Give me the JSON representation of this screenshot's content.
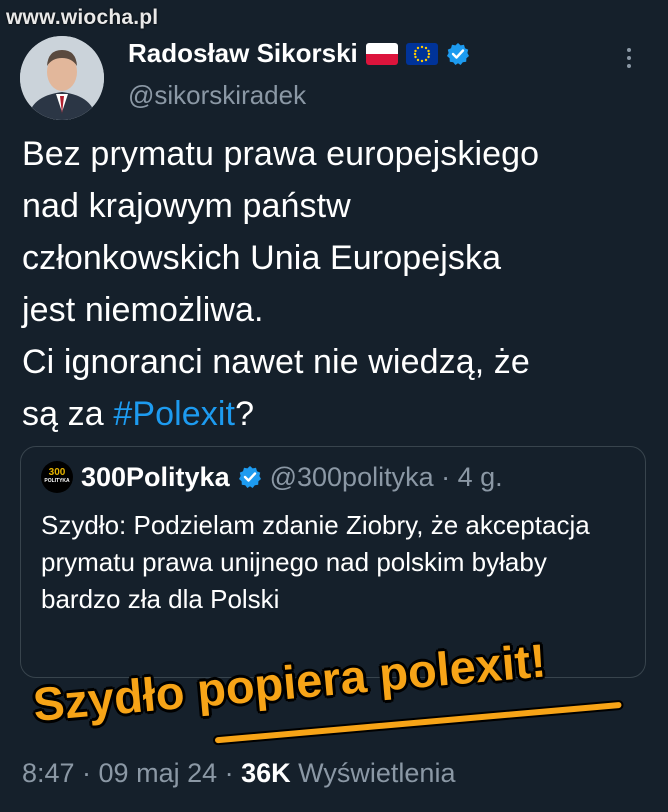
{
  "watermark": "www.wiocha.pl",
  "author": {
    "name": "Radosław Sikorski",
    "handle": "@sikorskiradek",
    "flags": [
      "poland-flag-icon",
      "eu-flag-icon"
    ],
    "verified_icon": "verified-badge-icon"
  },
  "tweet": {
    "lines": [
      "Bez prymatu prawa europejskiego",
      "nad krajowym państw",
      "członkowskich Unia Europejska",
      "jest niemożliwa.",
      "Ci ignoranci nawet nie wiedzą, że"
    ],
    "last_line_prefix": "są za ",
    "hashtag": "#Polexit",
    "last_line_suffix": "?"
  },
  "quote": {
    "logo_text_top": "300",
    "logo_text_bottom": "POLITYKA",
    "name": "300Polityka",
    "handle_time": "@300polityka · 4 g.",
    "text": "Szydło: Podzielam zdanie Ziobry, że akceptacja prymatu prawa unijnego nad polskim byłaby bardzo zła dla Polski"
  },
  "overlay_caption": "Szydło popiera polexit!",
  "footer": {
    "time_date": "8:47 · 09 maj 24 · ",
    "views_count": "36K",
    "views_label": " Wyświetlenia"
  },
  "colors": {
    "background": "#15202b",
    "link": "#1d9bf0",
    "secondary_text": "#8b98a5",
    "overlay": "#f7a417"
  }
}
